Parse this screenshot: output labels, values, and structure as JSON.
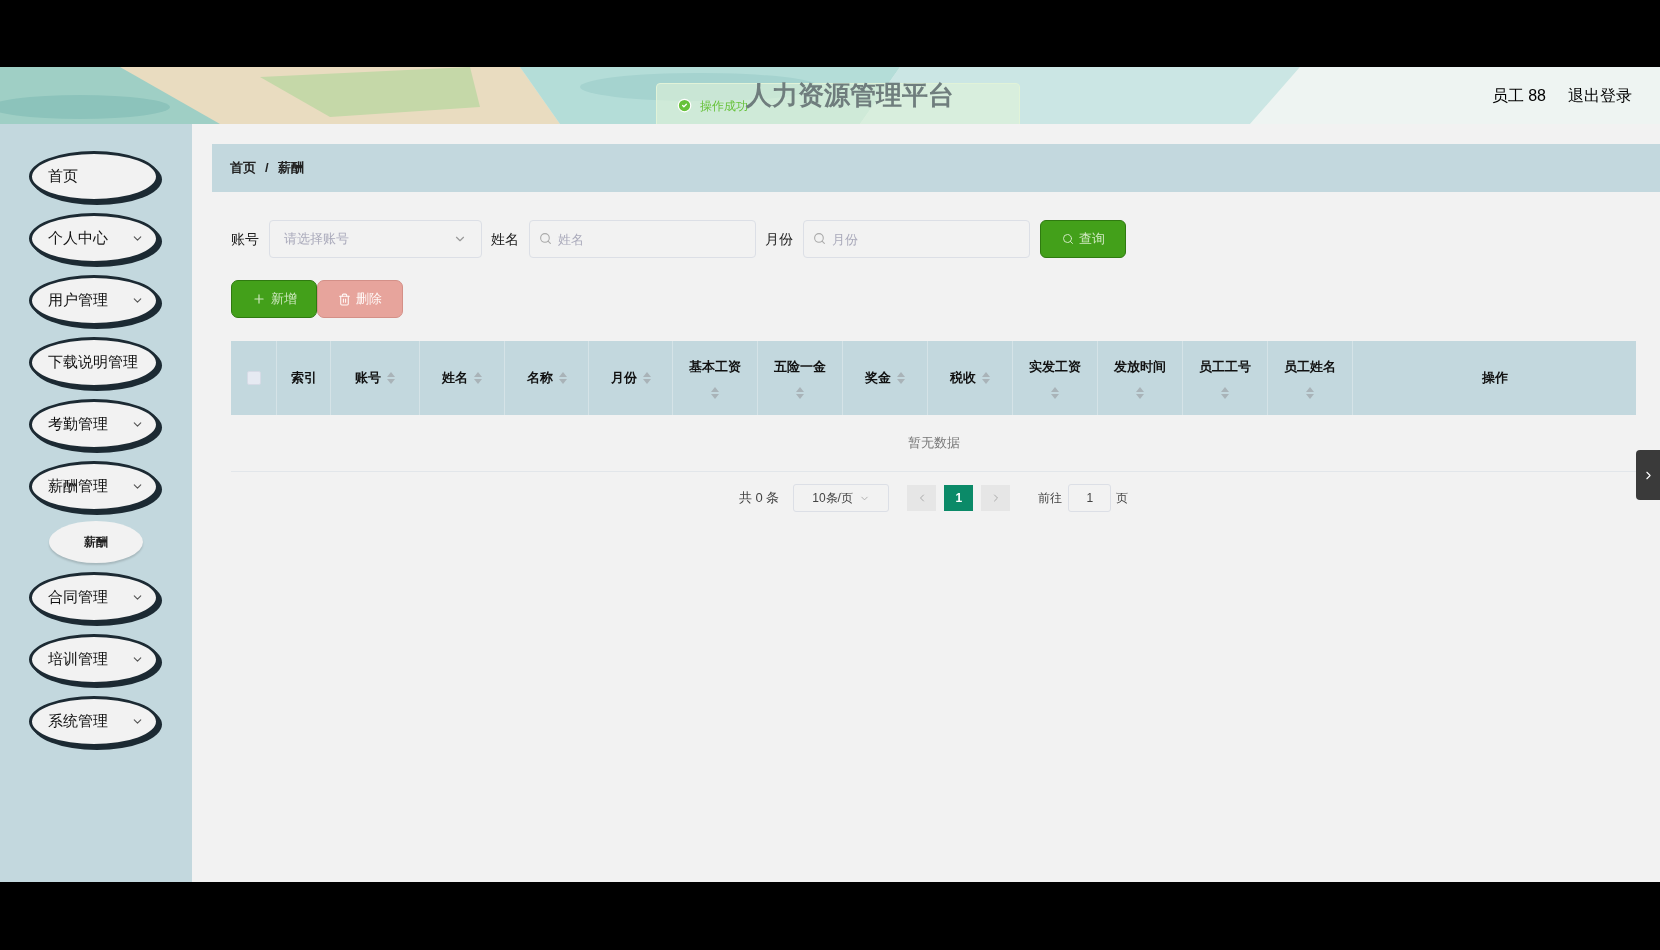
{
  "header": {
    "title": "人力资源管理平台",
    "user": "员工 88",
    "logout": "退出登录"
  },
  "toast": {
    "message": "操作成功"
  },
  "sidebar": {
    "items": [
      {
        "label": "首页",
        "expandable": false
      },
      {
        "label": "个人中心",
        "expandable": true
      },
      {
        "label": "用户管理",
        "expandable": true
      },
      {
        "label": "下载说明管理",
        "expandable": false
      },
      {
        "label": "考勤管理",
        "expandable": true
      },
      {
        "label": "薪酬管理",
        "expandable": true,
        "children": [
          {
            "label": "薪酬"
          }
        ]
      },
      {
        "label": "合同管理",
        "expandable": true
      },
      {
        "label": "培训管理",
        "expandable": true
      },
      {
        "label": "系统管理",
        "expandable": true
      }
    ]
  },
  "breadcrumb": [
    "首页",
    "/",
    "薪酬"
  ],
  "filters": [
    {
      "label": "账号",
      "kind": "select",
      "placeholder": "请选择账号"
    },
    {
      "label": "姓名",
      "kind": "search",
      "placeholder": "姓名"
    },
    {
      "label": "月份",
      "kind": "search",
      "placeholder": "月份"
    }
  ],
  "query_button": "查询",
  "actions": [
    {
      "label": "新增",
      "kind": "add",
      "disabled": false
    },
    {
      "label": "删除",
      "kind": "delete",
      "disabled": true
    }
  ],
  "table": {
    "select_all": {
      "checked": false
    },
    "columns": [
      {
        "label": "索引",
        "sortable": false
      },
      {
        "label": "账号",
        "sortable": true
      },
      {
        "label": "姓名",
        "sortable": true
      },
      {
        "label": "名称",
        "sortable": true
      },
      {
        "label": "月份",
        "sortable": true
      },
      {
        "label": "基本工资",
        "sortable": true
      },
      {
        "label": "五险一金",
        "sortable": true
      },
      {
        "label": "奖金",
        "sortable": true
      },
      {
        "label": "税收",
        "sortable": true
      },
      {
        "label": "实发工资",
        "sortable": true
      },
      {
        "label": "发放时间",
        "sortable": true
      },
      {
        "label": "员工工号",
        "sortable": true
      },
      {
        "label": "员工姓名",
        "sortable": true
      },
      {
        "label": "操作",
        "sortable": false
      }
    ],
    "empty_text": "暂无数据"
  },
  "pagination": {
    "total": "共 0 条",
    "page_size": "10条/页",
    "pages": [
      {
        "label": "1",
        "selected": true
      }
    ],
    "goto_label": "前往",
    "goto_value": "1",
    "page_suffix": "页"
  }
}
